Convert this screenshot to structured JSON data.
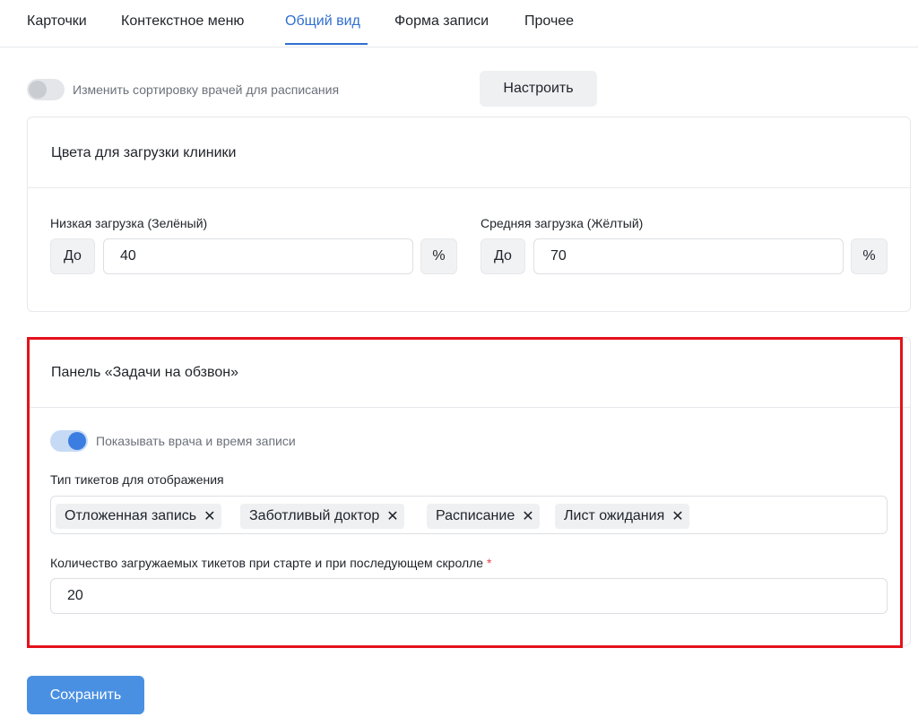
{
  "tabs": [
    {
      "label": "Карточки"
    },
    {
      "label": "Контекстное меню"
    },
    {
      "label": "Общий вид"
    },
    {
      "label": "Форма записи"
    },
    {
      "label": "Прочее"
    }
  ],
  "active_tab": "Общий вид",
  "sorting": {
    "toggle_on": false,
    "label": "Изменить сортировку врачей для расписания",
    "configure_button": "Настроить"
  },
  "load_colors": {
    "title": "Цвета для загрузки клиники",
    "low": {
      "label": "Низкая загрузка (Зелёный)",
      "prefix": "До",
      "value": "40",
      "suffix": "%"
    },
    "medium": {
      "label": "Средняя загрузка (Жёлтый)",
      "prefix": "До",
      "value": "70",
      "suffix": "%"
    }
  },
  "call_tasks": {
    "title": "Панель «Задачи на обзвон»",
    "show_doctor_toggle_on": true,
    "show_doctor_label": "Показывать врача и время записи",
    "ticket_types_label": "Тип тикетов для отображения",
    "ticket_types": [
      "Отложенная запись",
      "Заботливый доктор",
      "Расписание",
      "Лист ожидания"
    ],
    "tag_remove_glyph": "✕",
    "load_count_label": "Количество загружаемых тикетов при старте и при последующем скролле",
    "required_mark": "*",
    "load_count_value": "20"
  },
  "save_button": "Сохранить",
  "colors": {
    "accent": "#2f6fd0",
    "primary_button": "#4a90e2",
    "highlight_frame": "#e3121b",
    "required": "#e5484d"
  }
}
